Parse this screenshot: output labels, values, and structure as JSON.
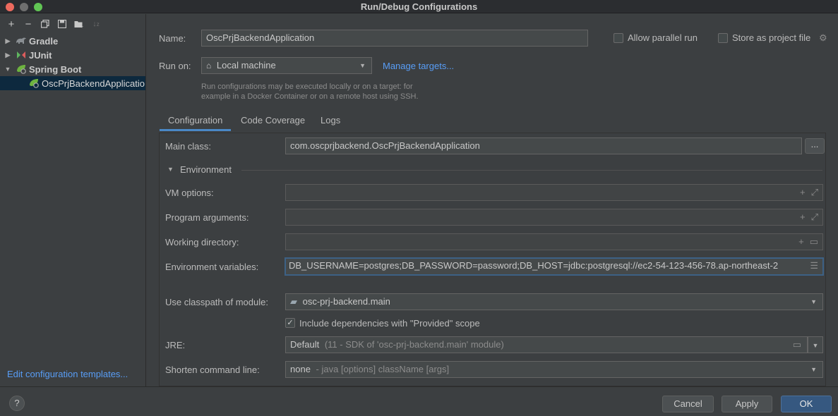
{
  "window": {
    "title": "Run/Debug Configurations"
  },
  "toolbar": {
    "icons": [
      "add-icon",
      "remove-icon",
      "copy-icon",
      "save-icon",
      "folder-add-icon",
      "sort-icon"
    ]
  },
  "tree": {
    "items": [
      {
        "label": "Gradle",
        "icon": "gradle-icon"
      },
      {
        "label": "JUnit",
        "icon": "junit-icon"
      },
      {
        "label": "Spring Boot",
        "icon": "spring-boot-icon"
      }
    ],
    "selected": "OscPrjBackendApplicatio"
  },
  "sidebar": {
    "edit_templates": "Edit configuration templates..."
  },
  "form": {
    "name_label": "Name:",
    "name_value": "OscPrjBackendApplication",
    "allow_parallel": "Allow parallel run",
    "store_as_file": "Store as project file",
    "run_on_label": "Run on:",
    "run_on_value": "Local machine",
    "manage_targets": "Manage targets...",
    "hint_line1": "Run configurations may be executed locally or on a target: for",
    "hint_line2": "example in a Docker Container or on a remote host using SSH."
  },
  "tabs": [
    {
      "label": "Configuration",
      "active": true
    },
    {
      "label": "Code Coverage",
      "active": false
    },
    {
      "label": "Logs",
      "active": false
    }
  ],
  "config": {
    "main_class_label": "Main class:",
    "main_class_value": "com.oscprjbackend.OscPrjBackendApplication",
    "browse_label": "...",
    "environment_label": "Environment",
    "vm_options_label": "VM options:",
    "program_args_label": "Program arguments:",
    "working_dir_label": "Working directory:",
    "env_vars_label": "Environment variables:",
    "env_vars_value": "DB_USERNAME=postgres;DB_PASSWORD=password;DB_HOST=jdbc:postgresql://ec2-54-123-456-78.ap-northeast-2",
    "classpath_label": "Use classpath of module:",
    "classpath_value": "osc-prj-backend.main",
    "include_deps_label": "Include dependencies with \"Provided\" scope",
    "jre_label": "JRE:",
    "jre_value": "Default",
    "jre_detail": "(11 - SDK of 'osc-prj-backend.main' module)",
    "shorten_label": "Shorten command line:",
    "shorten_value": "none",
    "shorten_detail": "- java [options] className [args]"
  },
  "footer": {
    "help": "?",
    "cancel": "Cancel",
    "apply": "Apply",
    "ok": "OK"
  }
}
